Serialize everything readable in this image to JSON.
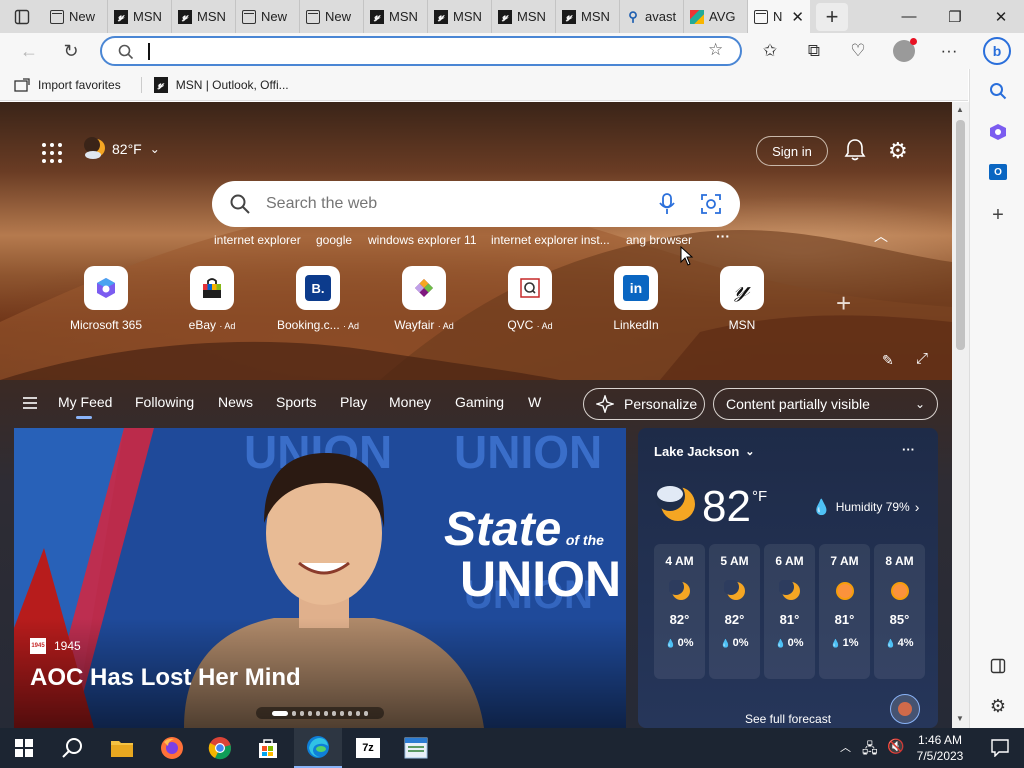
{
  "browser": {
    "tabs": [
      {
        "label": "New",
        "icon": "new-tab-icon"
      },
      {
        "label": "MSN",
        "icon": "msn-icon"
      },
      {
        "label": "MSN",
        "icon": "msn-icon"
      },
      {
        "label": "New",
        "icon": "new-tab-icon"
      },
      {
        "label": "New",
        "icon": "new-tab-icon"
      },
      {
        "label": "MSN",
        "icon": "msn-icon"
      },
      {
        "label": "MSN",
        "icon": "msn-icon"
      },
      {
        "label": "MSN",
        "icon": "msn-icon"
      },
      {
        "label": "MSN",
        "icon": "msn-icon"
      },
      {
        "label": "avast",
        "icon": "search-icon"
      },
      {
        "label": "AVG",
        "icon": "avg-icon"
      },
      {
        "label": "N",
        "icon": "new-tab-icon",
        "active": true
      }
    ],
    "address": {
      "value": "",
      "placeholder": ""
    },
    "favorites": [
      {
        "label": "Import favorites",
        "icon": "import-icon"
      },
      {
        "label": "MSN | Outlook, Offi...",
        "icon": "msn-icon"
      }
    ]
  },
  "hero": {
    "weather_temp": "82°F",
    "sign_in": "Sign in",
    "search_placeholder": "Search the web",
    "trending": [
      "internet explorer",
      "google",
      "windows explorer 11",
      "internet explorer inst...",
      "ang browser"
    ],
    "trending_more": "···",
    "tiles": [
      {
        "label": "Microsoft 365",
        "ad": ""
      },
      {
        "label": "eBay",
        "ad": "· Ad"
      },
      {
        "label": "Booking.c...",
        "ad": "· Ad"
      },
      {
        "label": "Wayfair",
        "ad": "· Ad"
      },
      {
        "label": "QVC",
        "ad": "· Ad"
      },
      {
        "label": "LinkedIn",
        "ad": ""
      },
      {
        "label": "MSN",
        "ad": ""
      }
    ],
    "add_tile": "+"
  },
  "feed": {
    "tabs": [
      "My Feed",
      "Following",
      "News",
      "Sports",
      "Play",
      "Money",
      "Gaming",
      "W"
    ],
    "personalize": "Personalize",
    "visibility": "Content partially visible"
  },
  "news_card": {
    "source_badge": "1945",
    "source": "1945",
    "headline": "AOC Has Lost Her Mind",
    "overlay_line1": "State",
    "overlay_line2": "of the",
    "overlay_line3": "UNION",
    "carousel_count": 11
  },
  "weather": {
    "location": "Lake Jackson",
    "temp": "82",
    "unit": "°F",
    "humidity": "Humidity 79%",
    "hours": [
      {
        "time": "4 AM",
        "temp": "82°",
        "precip": "0%",
        "icon": "moon-icon"
      },
      {
        "time": "5 AM",
        "temp": "82°",
        "precip": "0%",
        "icon": "moon-icon"
      },
      {
        "time": "6 AM",
        "temp": "81°",
        "precip": "0%",
        "icon": "moon-icon"
      },
      {
        "time": "7 AM",
        "temp": "81°",
        "precip": "1%",
        "icon": "sun-icon"
      },
      {
        "time": "8 AM",
        "temp": "85°",
        "precip": "4%",
        "icon": "sun-icon"
      }
    ],
    "forecast_link": "See full forecast"
  },
  "taskbar": {
    "time": "1:46 AM",
    "date": "7/5/2023",
    "apps": [
      "start",
      "search",
      "file-explorer",
      "firefox",
      "chrome",
      "store",
      "edge",
      "7zip",
      "notepad"
    ]
  },
  "colors": {
    "accent": "#4a86d4",
    "taskbar": "#1c2532",
    "weather_card": "#26365a"
  }
}
